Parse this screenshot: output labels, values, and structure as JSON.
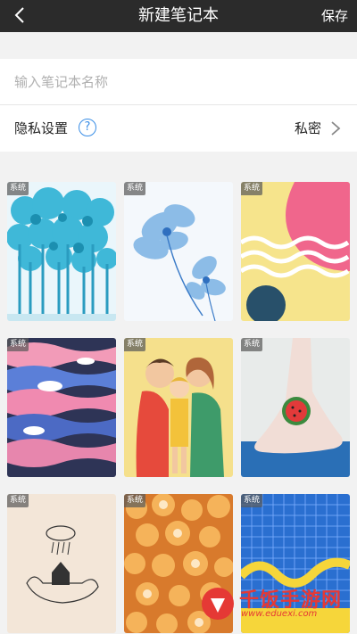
{
  "header": {
    "title": "新建笔记本",
    "save_label": "保存",
    "back_icon": "chevron-left-icon"
  },
  "form": {
    "name_placeholder": "输入笔记本名称",
    "name_value": "",
    "privacy_label": "隐私设置",
    "privacy_help": "?",
    "privacy_value": "私密"
  },
  "covers": [
    {
      "badge": "系统",
      "theme": "blue-forest"
    },
    {
      "badge": "系统",
      "theme": "blue-flower"
    },
    {
      "badge": "系统",
      "theme": "pink-waves"
    },
    {
      "badge": "系统",
      "theme": "whale-sea"
    },
    {
      "badge": "系统",
      "theme": "family-hug"
    },
    {
      "badge": "系统",
      "theme": "watermelon-foot"
    },
    {
      "badge": "系统",
      "theme": "house-in-hand"
    },
    {
      "badge": "系统",
      "theme": "orange-chrysanthemum"
    },
    {
      "badge": "系统",
      "theme": "blue-grid-wave"
    }
  ],
  "watermark": {
    "name": "千饭手游网",
    "url": "www.eduexi.com"
  },
  "colors": {
    "navbar": "#2b2b2b",
    "accent": "#3a8ee6",
    "watermark": "#e53935"
  }
}
